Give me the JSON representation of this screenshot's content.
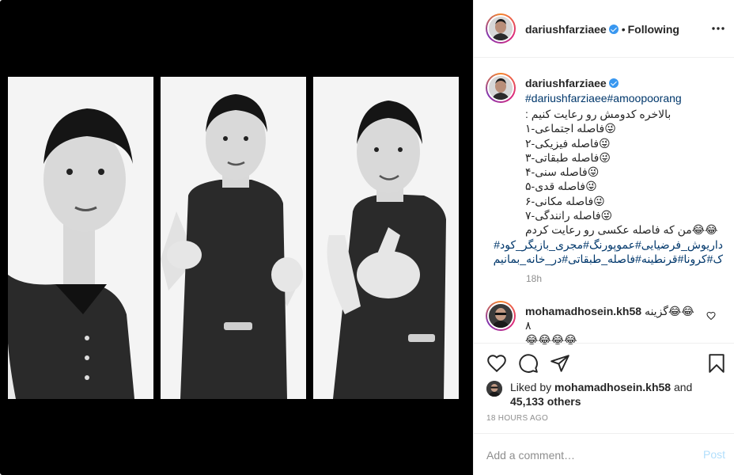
{
  "post": {
    "username": "dariushfarziaee",
    "separator": "•",
    "follow_status": "Following"
  },
  "caption": {
    "username": "dariushfarziaee",
    "hashtags": "#dariushfarziaee#amoopoorang",
    "lines": [
      "بالاخره کدومش رو رعایت کنیم :",
      "😜فاصله اجتماعی-۱",
      "😜فاصله فیزیکی-۲",
      "😜فاصله طبقاتی-۳",
      "😜فاصله سنی-۴",
      "😜فاصله قدی-۵",
      "😜فاصله مکانی-۶",
      "😜فاصله رانندگی-۷",
      "😂😂من که فاصله عکسی رو رعایت کردم"
    ],
    "tag_lines": [
      "داریوش_فرضیایی#عموپورنگ#مجری_بازیگر_کود#",
      "ک#کرونا#قرنطینه#فاصله_طبقاتی#در_خانه_بمانیم"
    ],
    "time": "18h"
  },
  "comment": {
    "username": "mohamadhosein.kh58",
    "text_line1": "😂😂گزینه ۸",
    "text_line2": "😂😂😂😂"
  },
  "likes": {
    "prefix": "Liked by ",
    "username": "mohamadhosein.kh58",
    "middle": " and",
    "count": "45,133 others"
  },
  "timestamp": "18 HOURS AGO",
  "add_comment": {
    "placeholder": "Add a comment…",
    "post_label": "Post"
  },
  "icons": {
    "more": "more-options-icon",
    "like": "heart-icon",
    "comment": "comment-icon",
    "share": "paper-plane-icon",
    "save": "bookmark-icon",
    "verified": "verified-badge-icon"
  },
  "colors": {
    "link": "#00376b",
    "verified": "#3897f0",
    "muted": "#8e8e8e",
    "post_disabled": "#b2dffc"
  }
}
